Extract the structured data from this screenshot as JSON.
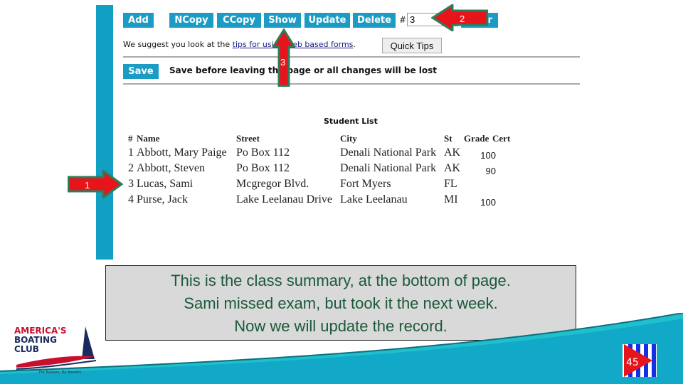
{
  "toolbar": {
    "add": "Add",
    "ncopy": "NCopy",
    "ccopy": "CCopy",
    "show": "Show",
    "update": "Update",
    "delete": "Delete",
    "hash_label": "#",
    "record_value": "3",
    "partial_button": "r"
  },
  "suggest": {
    "prefix": "We suggest you look at the ",
    "link": "tips for using web based forms",
    "suffix": ".",
    "quick_tips": "Quick Tips"
  },
  "save": {
    "label": "Save",
    "message": "Save before leaving the page or all changes will be lost"
  },
  "student_list": {
    "title": "Student List",
    "headers": [
      "#",
      "Name",
      "Street",
      "City",
      "St",
      "Grade",
      "Cert"
    ],
    "rows": [
      {
        "num": "1",
        "name": "Abbott, Mary Paige",
        "street": "Po Box 112",
        "city": "Denali National Park",
        "st": "AK",
        "grade": "100"
      },
      {
        "num": "2",
        "name": "Abbott, Steven",
        "street": "Po Box 112",
        "city": "Denali National Park",
        "st": "AK",
        "grade": "90"
      },
      {
        "num": "3",
        "name": "Lucas, Sami",
        "street": "Mcgregor Blvd.",
        "city": "Fort Myers",
        "st": "FL",
        "grade": ""
      },
      {
        "num": "4",
        "name": "Purse, Jack",
        "street": "Lake Leelanau Drive",
        "city": "Lake Leelanau",
        "st": "MI",
        "grade": "100"
      }
    ]
  },
  "callouts": {
    "arrow1": "1",
    "arrow2": "2",
    "arrow3": "3"
  },
  "summary": {
    "line1": "This is the class summary, at the bottom of page.",
    "line2": "Sami missed exam, but took it the next week.",
    "line3": "Now we will update the record."
  },
  "logo": {
    "line1": "AMERICA'S",
    "line2": "BOATING",
    "line3": "CLUB",
    "tagline": "For Boaters, By Boaters"
  },
  "page_number": "45",
  "colors": {
    "accent": "#1c9cc4",
    "arrow_fill": "#e8141b",
    "arrow_border": "#2e7d5a",
    "summary_text": "#1a5a3a"
  }
}
